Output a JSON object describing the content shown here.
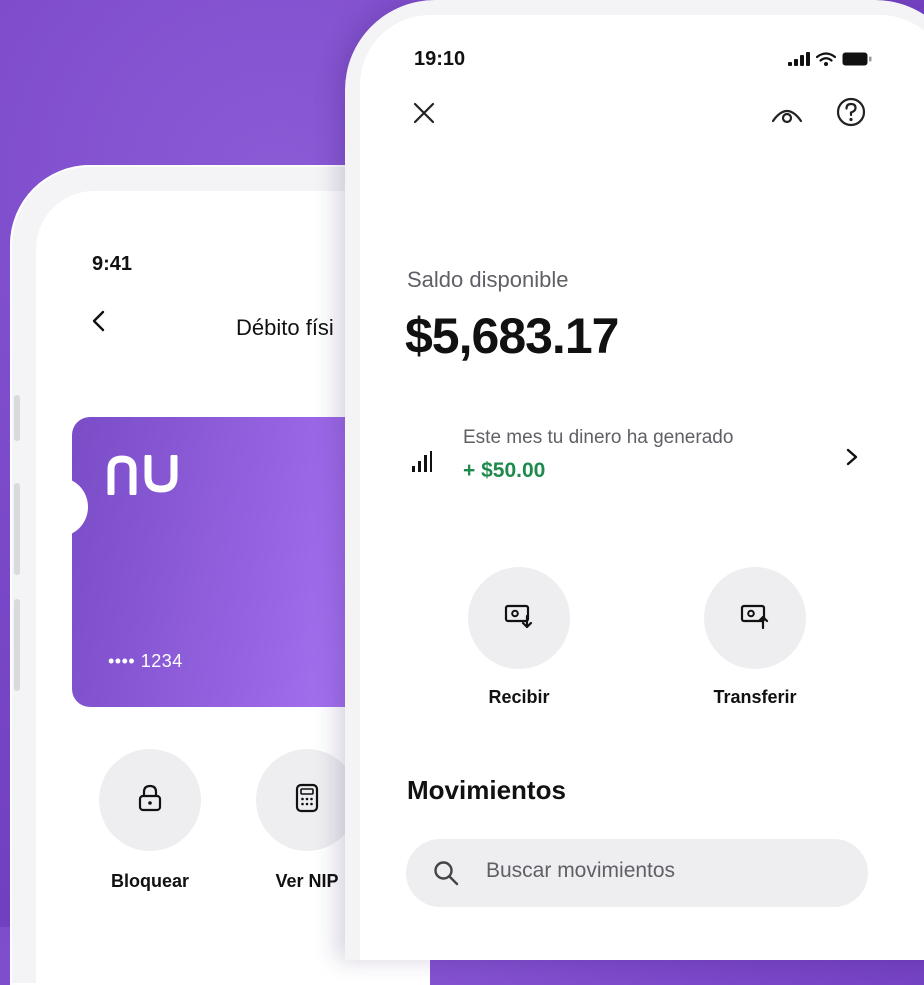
{
  "back_phone": {
    "time": "9:41",
    "title": "Débito físi",
    "card": {
      "number": "•••• 1234"
    },
    "actions": [
      {
        "label": "Bloquear",
        "icon": "lock-icon"
      },
      {
        "label": "Ver NIP",
        "icon": "keypad-icon"
      }
    ]
  },
  "front_phone": {
    "time": "19:10",
    "balance": {
      "label": "Saldo disponible",
      "amount": "$5,683.17"
    },
    "earnings": {
      "text": "Este mes tu dinero ha generado",
      "amount": "+ $50.00"
    },
    "actions": [
      {
        "label": "Recibir",
        "icon": "receive-money-icon"
      },
      {
        "label": "Transferir",
        "icon": "transfer-money-icon"
      }
    ],
    "movements": {
      "title": "Movimientos",
      "search_placeholder": "Buscar movimientos"
    }
  },
  "colors": {
    "background": "#7a48c9",
    "card_gradient_start": "#7a4cc6",
    "card_gradient_end": "#b684ff",
    "earn_green": "#1e8a4c"
  }
}
